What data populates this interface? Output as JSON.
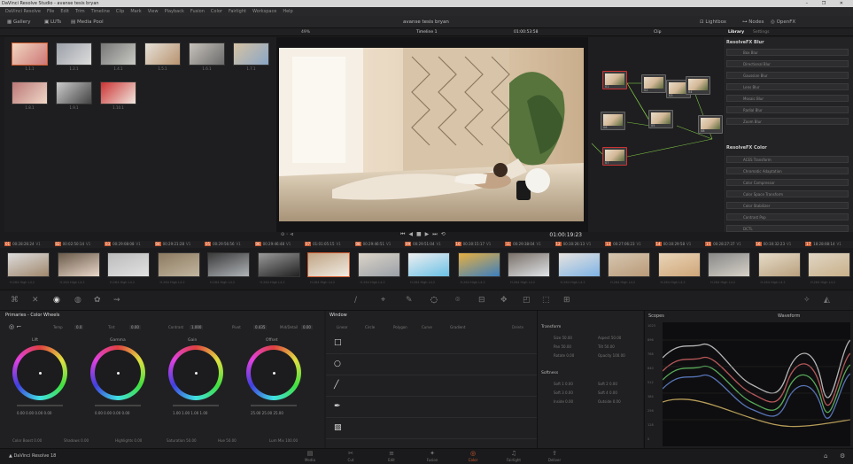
{
  "titlebar": {
    "title": "DaVinci Resolve Studio - avanse tesis bryan",
    "controls": "– ❐ ✕"
  },
  "menubar": {
    "items": [
      "DaVinci Resolve",
      "File",
      "Edit",
      "Trim",
      "Timeline",
      "Clip",
      "Mark",
      "View",
      "Playback",
      "Fusion",
      "Color",
      "Fairlight",
      "Workspace",
      "Help"
    ]
  },
  "toolbar": {
    "gallery": "Gallery",
    "lut": "LUTs",
    "mediapool": "Media Pool",
    "project": "avanse tesis bryan",
    "lightbox": "Lightbox",
    "nodes_btn": "Nodes",
    "openfx": "OpenFX",
    "lib": "Lightbox",
    "fx": "OpenFX"
  },
  "subbar": {
    "timeline": "Timeline 1",
    "timecode_small": "01:00:53:58",
    "clip": "Clip",
    "library_tab": "Library",
    "settings_tab": "Settings",
    "zoom": "49%"
  },
  "viewer": {
    "timecode": "01:00:19:23",
    "track": "V1"
  },
  "stills": [
    {
      "label": "1.1.1"
    },
    {
      "label": "1.2.1"
    },
    {
      "label": "1.4.1"
    },
    {
      "label": "1.5.1"
    },
    {
      "label": "1.6.1"
    },
    {
      "label": "1.7.1"
    },
    {
      "label": "1.8.1"
    },
    {
      "label": "1.9.1"
    },
    {
      "label": "1.10.1"
    }
  ],
  "nodes": [
    {
      "id": "01"
    },
    {
      "id": "02"
    },
    {
      "id": "03"
    },
    {
      "id": "04"
    },
    {
      "id": "05"
    },
    {
      "id": "06"
    },
    {
      "id": "07"
    },
    {
      "id": "08"
    }
  ],
  "library": {
    "section1": "ResolveFX Blur",
    "blur_items": [
      "Box Blur",
      "Directional Blur",
      "Gaussian Blur",
      "Lens Blur",
      "Mosaic Blur",
      "Radial Blur",
      "Zoom Blur"
    ],
    "section2": "ResolveFX Color",
    "color_items": [
      "ACES Transform",
      "Chromatic Adaptation",
      "Color Compressor",
      "Color Space Transform",
      "Color Stabilizer",
      "Contrast Pop",
      "DCTL"
    ]
  },
  "clips": [
    {
      "n": "01",
      "tc": "00:28:26:24",
      "v": "V1"
    },
    {
      "n": "02",
      "tc": "00:02:50:14",
      "v": "V1"
    },
    {
      "n": "03",
      "tc": "00:29:08:08",
      "v": "V1"
    },
    {
      "n": "04",
      "tc": "00:29:21:28",
      "v": "V1"
    },
    {
      "n": "05",
      "tc": "00:29:56:56",
      "v": "V1"
    },
    {
      "n": "06",
      "tc": "00:29:46:48",
      "v": "V1"
    },
    {
      "n": "07",
      "tc": "01:01:05:15",
      "v": "V1"
    },
    {
      "n": "08",
      "tc": "00:29:46:51",
      "v": "V1"
    },
    {
      "n": "09",
      "tc": "00:29:51:04",
      "v": "V1"
    },
    {
      "n": "10",
      "tc": "00:30:15:17",
      "v": "V1"
    },
    {
      "n": "11",
      "tc": "00:29:38:04",
      "v": "V1"
    },
    {
      "n": "12",
      "tc": "00:30:26:13",
      "v": "V1"
    },
    {
      "n": "13",
      "tc": "00:27:06:23",
      "v": "V1"
    },
    {
      "n": "14",
      "tc": "00:30:29:58",
      "v": "V1"
    },
    {
      "n": "15",
      "tc": "00:28:27:37",
      "v": "V1"
    },
    {
      "n": "16",
      "tc": "00:30:32:23",
      "v": "V1"
    },
    {
      "n": "17",
      "tc": "18:28:08:14",
      "v": "V1"
    }
  ],
  "cliplabel": "H.264 High L4.2",
  "colorwheels": {
    "title": "Primaries - Color Wheels",
    "temp_label": "Temp",
    "temp": "0.0",
    "tint_label": "Tint",
    "tint": "0.00",
    "contrast_label": "Contrast",
    "contrast": "1.000",
    "pivot_label": "Pivot",
    "pivot": "0.435",
    "middetail_label": "Mid/Detail",
    "middetail": "0.00",
    "wheels": [
      {
        "name": "Lift",
        "vals": "0.00 0.00 0.00 0.00"
      },
      {
        "name": "Gamma",
        "vals": "0.00 0.00 0.00 0.00"
      },
      {
        "name": "Gain",
        "vals": "1.00 1.00 1.00 1.00"
      },
      {
        "name": "Offset",
        "vals": "25.00 25.00 25.00"
      }
    ],
    "bottom": [
      "Color Boost 0.00",
      "Shadows 0.00",
      "Highlights 0.00",
      "Saturation 50.00",
      "Hue 50.00",
      "Lum Mix 100.00"
    ]
  },
  "windowpanel": {
    "title": "Window",
    "tools": [
      "Linear",
      "Circle",
      "Polygon",
      "Curve",
      "Gradient"
    ],
    "delete": "Delete"
  },
  "transform": {
    "title": "Transform",
    "softness": "Softness",
    "fields1": [
      "Size 50.00",
      "Aspect 50.00",
      "Pan 50.00",
      "Tilt 50.00",
      "Rotate 0.00",
      "Opacity 100.00"
    ],
    "fields2": [
      "Soft 1 0.00",
      "Soft 2 0.00",
      "Soft 3 0.00",
      "Soft 4 0.00",
      "Inside 0.00",
      "Outside 0.00"
    ]
  },
  "scopes": {
    "title": "Scopes",
    "mode": "Waveform",
    "ticks": [
      "1023",
      "896",
      "768",
      "640",
      "512",
      "384",
      "256",
      "128",
      "0"
    ]
  },
  "pages": [
    {
      "label": "Media",
      "icon": "▤"
    },
    {
      "label": "Cut",
      "icon": "✂"
    },
    {
      "label": "Edit",
      "icon": "≡"
    },
    {
      "label": "Fusion",
      "icon": "✦"
    },
    {
      "label": "Color",
      "icon": "◎"
    },
    {
      "label": "Fairlight",
      "icon": "♫"
    },
    {
      "label": "Deliver",
      "icon": "⇪"
    }
  ],
  "app_name": "DaVinci Resolve 18",
  "colors": {
    "accent": "#d05a2e",
    "panel": "#202022",
    "bg": "#1b1b1d"
  }
}
